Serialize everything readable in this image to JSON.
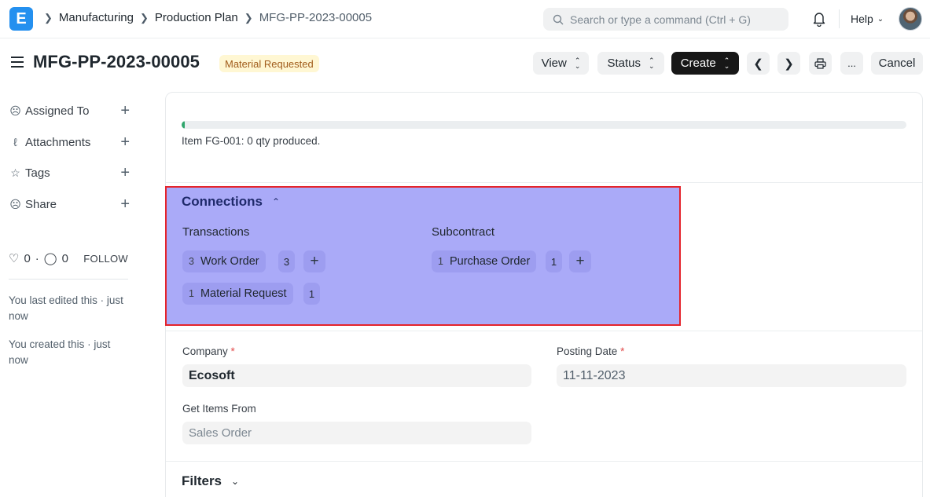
{
  "navbar": {
    "logo_letter": "E",
    "breadcrumbs": [
      "Manufacturing",
      "Production Plan",
      "MFG-PP-2023-00005"
    ],
    "search_placeholder": "Search or type a command (Ctrl + G)",
    "help_label": "Help"
  },
  "page": {
    "title": "MFG-PP-2023-00005",
    "status": "Material Requested",
    "buttons": {
      "view": "View",
      "status": "Status",
      "create": "Create",
      "more": "...",
      "cancel": "Cancel"
    }
  },
  "sidebar": {
    "items": [
      {
        "label": "Assigned To",
        "icon": "assign-icon"
      },
      {
        "label": "Attachments",
        "icon": "paperclip-icon"
      },
      {
        "label": "Tags",
        "icon": "tag-icon"
      },
      {
        "label": "Share",
        "icon": "share-icon"
      }
    ],
    "likes_count": "0",
    "comments_count": "0",
    "follow_label": "FOLLOW",
    "last_edited": "You last edited this · just now",
    "created": "You created this · just now"
  },
  "progress": {
    "fraction": 0.004,
    "text": "Item FG-001: 0 qty produced."
  },
  "connections": {
    "title": "Connections",
    "groups": [
      {
        "label": "Transactions",
        "items": [
          {
            "count": "3",
            "label": "Work Order",
            "badge": "3"
          },
          {
            "count": "1",
            "label": "Material Request",
            "badge": "1"
          }
        ]
      },
      {
        "label": "Subcontract",
        "items": [
          {
            "count": "1",
            "label": "Purchase Order",
            "badge": "1"
          }
        ]
      }
    ]
  },
  "form": {
    "company_label": "Company",
    "company_value": "Ecosoft",
    "posting_date_label": "Posting Date",
    "posting_date_value": "11-11-2023",
    "get_items_label": "Get Items From",
    "get_items_value": "Sales Order",
    "required_marker": "*"
  },
  "filters": {
    "title": "Filters"
  },
  "colors": {
    "brand": "#2490ef",
    "status_bg": "#fff7d3",
    "status_text": "#a15c1b",
    "progress": "#30a66d",
    "highlight": "#aaaaf8",
    "highlight_border": "#e5242b"
  }
}
